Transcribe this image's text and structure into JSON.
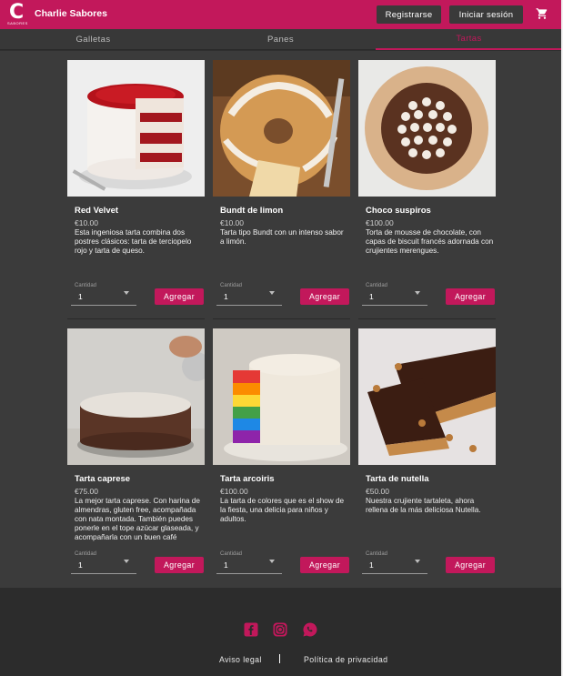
{
  "header": {
    "logo_letter": "C",
    "logo_sub": "SABORES",
    "brand": "Charlie Sabores",
    "register_label": "Registrarse",
    "login_label": "Iniciar sesión",
    "cart_icon": "cart-icon",
    "brand_color": "#c2185b"
  },
  "tabs": [
    {
      "label": "Galletas",
      "active": false
    },
    {
      "label": "Panes",
      "active": false
    },
    {
      "label": "Tartas",
      "active": true
    }
  ],
  "products": [
    {
      "title": "Red Velvet",
      "price": "€10.00",
      "description": "Esta ingeniosa tarta combina dos postres clásicos: tarta de terciopelo rojo y tarta de queso.",
      "qty_label": "Cantidad",
      "qty_value": "1",
      "add_label": "Agregar"
    },
    {
      "title": "Bundt de limon",
      "price": "€10.00",
      "description": "Tarta tipo Bundt con un intenso sabor a limón.",
      "qty_label": "Cantidad",
      "qty_value": "1",
      "add_label": "Agregar"
    },
    {
      "title": "Choco suspiros",
      "price": "€100.00",
      "description": "Torta de mousse de chocolate, con capas de biscuit francés adornada con crujientes merengues.",
      "qty_label": "Cantidad",
      "qty_value": "1",
      "add_label": "Agregar"
    },
    {
      "title": "Tarta caprese",
      "price": "€75.00",
      "description": "La mejor tarta caprese. Con harina de almendras, gluten free, acompañada con nata montada. También puedes ponerle en el tope azúcar glaseada, y acompañarla con un buen café",
      "qty_label": "Cantidad",
      "qty_value": "1",
      "add_label": "Agregar"
    },
    {
      "title": "Tarta arcoiris",
      "price": "€100.00",
      "description": "La tarta de colores que es el show de la fiesta, una delicia para niños y adultos.",
      "qty_label": "Cantidad",
      "qty_value": "1",
      "add_label": "Agregar"
    },
    {
      "title": "Tarta de nutella",
      "price": "€50.00",
      "description": "Nuestra crujiente tartaleta, ahora rellena de la más deliciosa Nutella.",
      "qty_label": "Cantidad",
      "qty_value": "1",
      "add_label": "Agregar"
    }
  ],
  "footer": {
    "social_icons": [
      "facebook-icon",
      "instagram-icon",
      "whatsapp-icon"
    ],
    "legal_label": "Aviso legal",
    "divider": "|",
    "privacy_label": "Política de privacidad"
  }
}
